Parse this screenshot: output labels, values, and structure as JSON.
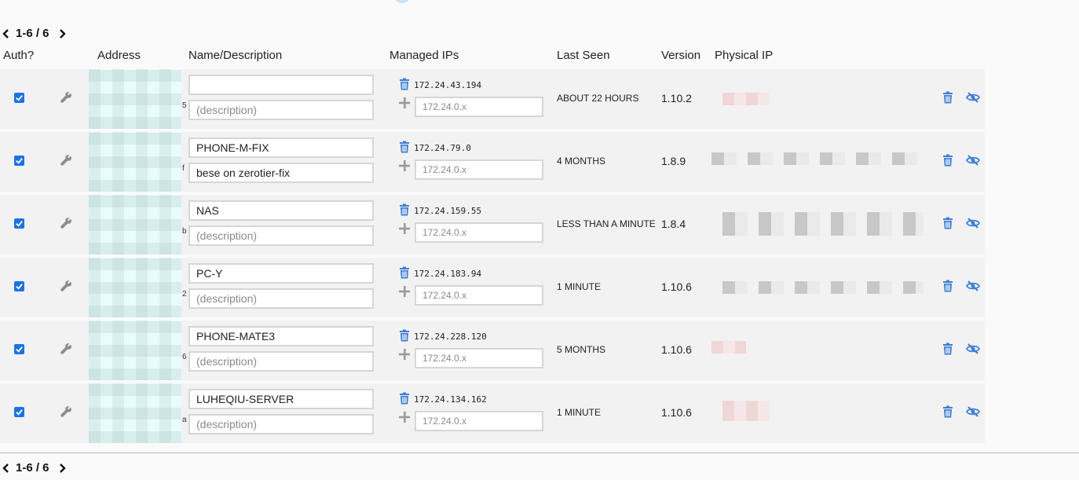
{
  "pagination": {
    "label": "1-6 / 6"
  },
  "headers": {
    "auth": "Auth?",
    "address": "Address",
    "name": "Name/Description",
    "managed_ips": "Managed IPs",
    "last_seen": "Last Seen",
    "version": "Version",
    "physical_ip": "Physical IP"
  },
  "ip_placeholder": "172.24.0.x",
  "description_placeholder": "(description)",
  "colors": {
    "accent": "#1a73e8",
    "icon_blue": "#3b7fd6",
    "icon_gray": "#8c8c8c"
  },
  "members": [
    {
      "authorized": true,
      "address_tail": "5",
      "name": "",
      "description": "",
      "ip": "172.24.43.194",
      "last_seen": "ABOUT 22 HOURS",
      "version": "1.10.2"
    },
    {
      "authorized": true,
      "address_tail": "f",
      "name": "PHONE-M-FIX",
      "description": "bese on zerotier-fix",
      "ip": "172.24.79.0",
      "last_seen": "4 MONTHS",
      "version": "1.8.9"
    },
    {
      "authorized": true,
      "address_tail": "b",
      "name": "NAS",
      "description": "",
      "ip": "172.24.159.55",
      "last_seen": "LESS THAN A MINUTE",
      "version": "1.8.4"
    },
    {
      "authorized": true,
      "address_tail": "2",
      "name": "PC-Y",
      "description": "",
      "ip": "172.24.183.94",
      "last_seen": "1 MINUTE",
      "version": "1.10.6"
    },
    {
      "authorized": true,
      "address_tail": "6",
      "name": "PHONE-MATE3",
      "description": "",
      "ip": "172.24.228.120",
      "last_seen": "5 MONTHS",
      "version": "1.10.6"
    },
    {
      "authorized": true,
      "address_tail": "a",
      "name": "LUHEQIU-SERVER",
      "description": "",
      "ip": "172.24.134.162",
      "last_seen": "1 MINUTE",
      "version": "1.10.6"
    }
  ]
}
